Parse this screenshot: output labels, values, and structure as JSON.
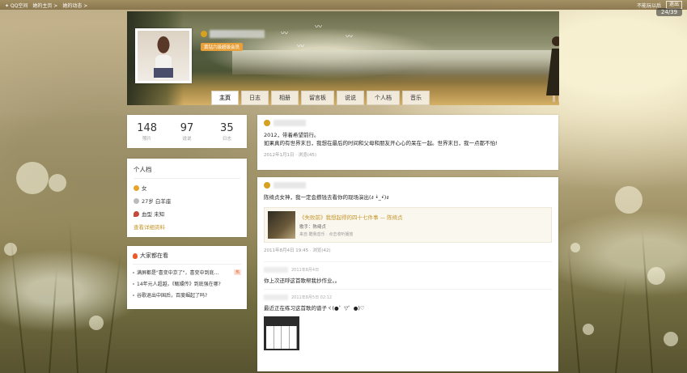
{
  "topbar": {
    "nav": [
      "✦ QQ空间",
      "她的主页 >",
      "她的动态 >"
    ],
    "message": "不能玩以后",
    "logout": "退出"
  },
  "counter": "24/39",
  "header": {
    "vip_tag": "黄钻六级超级会员"
  },
  "tabs": [
    {
      "label": "主页",
      "active": true
    },
    {
      "label": "日志",
      "active": false
    },
    {
      "label": "相册",
      "active": false
    },
    {
      "label": "留言板",
      "active": false
    },
    {
      "label": "说说",
      "active": false
    },
    {
      "label": "个人档",
      "active": false
    },
    {
      "label": "音乐",
      "active": false
    }
  ],
  "stats": [
    {
      "num": "148",
      "label": "照片"
    },
    {
      "num": "97",
      "label": "说说"
    },
    {
      "num": "35",
      "label": "日志"
    }
  ],
  "profile": {
    "title": "个人档",
    "rows": [
      {
        "text": "女",
        "color": "#e6a42a"
      },
      {
        "text": "27岁 白羊座",
        "color": "#bbbbbb"
      },
      {
        "text": "血型 未知",
        "color": "#c44a3a"
      }
    ],
    "more": "查看详细资料"
  },
  "hot": {
    "title": "大家都在看",
    "items": [
      {
        "text": "满屏都是\"喜变中京了\"，喜变中到底…",
        "badge": "热"
      },
      {
        "text": "14年元人超越，《甄嬛传》到底强在哪?",
        "badge": ""
      },
      {
        "text": "谷歌退出中国后，百度崛起了吗?",
        "badge": ""
      }
    ]
  },
  "post1": {
    "text1": "2012，带着希望前行。",
    "text2": "如果真的有世界末日，我想在最后的时间和父母和朋友开心心的呆在一起。世界末日，我一点都不怕!",
    "meta": "2012年1月1日 · 浏览(45)"
  },
  "post2": {
    "text": "陈绮贞女神，我一定会攒钱去看你的现场演出(ง •̀_•́)ง",
    "music_title": "《失败前》我想起得的四十七件事 — 陈绮贞",
    "music_sub": "歌手：陈绮贞",
    "music_src": "来自 酷我音乐 · 点击收听播放",
    "meta": "2011年8月4日 19:45 · 浏览(42)"
  },
  "comments": [
    {
      "when": "2011年8月4日",
      "said": "你上次还呼这首歌帮我抄作业。。"
    },
    {
      "when": "2011年8月5日 02:12",
      "said": "最近正在练习这首歌的谱子ヾ(●゜▽゜●)♡"
    }
  ]
}
